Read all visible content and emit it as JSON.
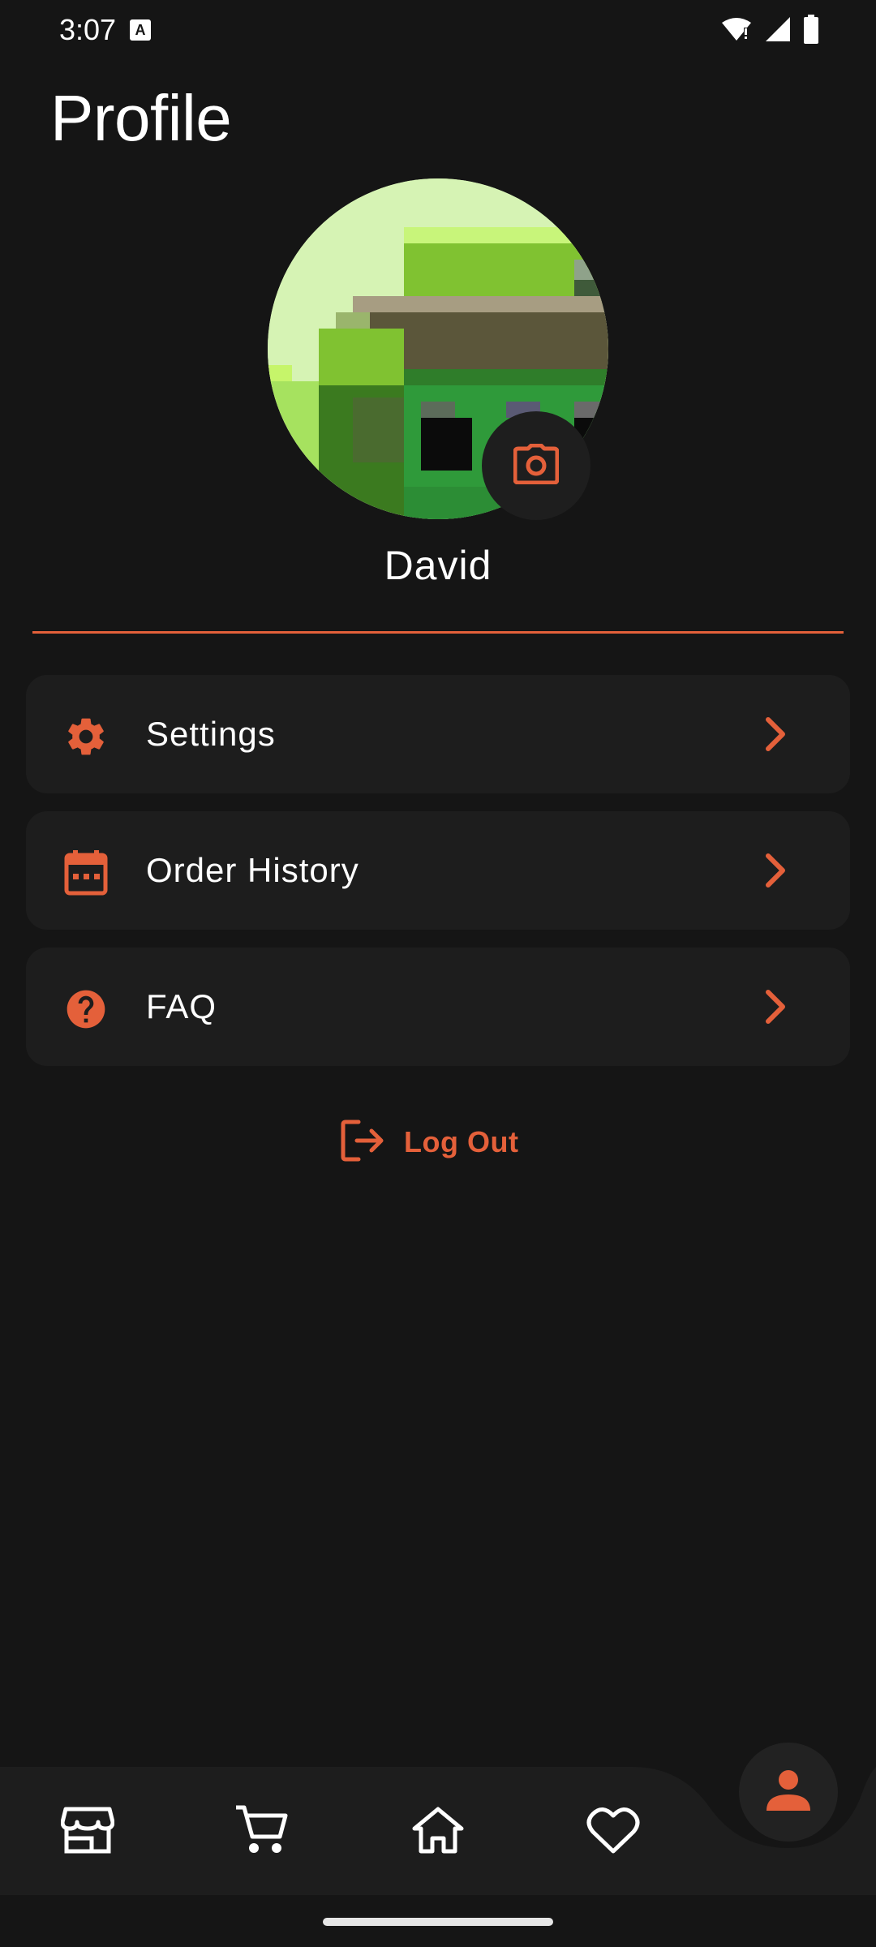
{
  "status_bar": {
    "time": "3:07",
    "notification_icon": "A",
    "icons": [
      "wifi-icon",
      "signal-icon",
      "battery-icon"
    ]
  },
  "page": {
    "title": "Profile"
  },
  "profile": {
    "name": "David",
    "avatar_icon": "pixel-avatar-image",
    "camera_icon": "camera-icon"
  },
  "menu": {
    "items": [
      {
        "label": "Settings",
        "icon": "gear-icon"
      },
      {
        "label": "Order History",
        "icon": "calendar-icon"
      },
      {
        "label": "FAQ",
        "icon": "help-circle-icon"
      }
    ]
  },
  "logout": {
    "label": "Log Out",
    "icon": "logout-icon"
  },
  "bottom_nav": {
    "items": [
      "store-icon",
      "cart-icon",
      "home-icon",
      "heart-icon",
      "person-icon"
    ],
    "active": "person-icon"
  },
  "colors": {
    "background": "#151515",
    "card": "#1d1d1d",
    "accent": "#e4603a",
    "text": "#ffffff"
  }
}
